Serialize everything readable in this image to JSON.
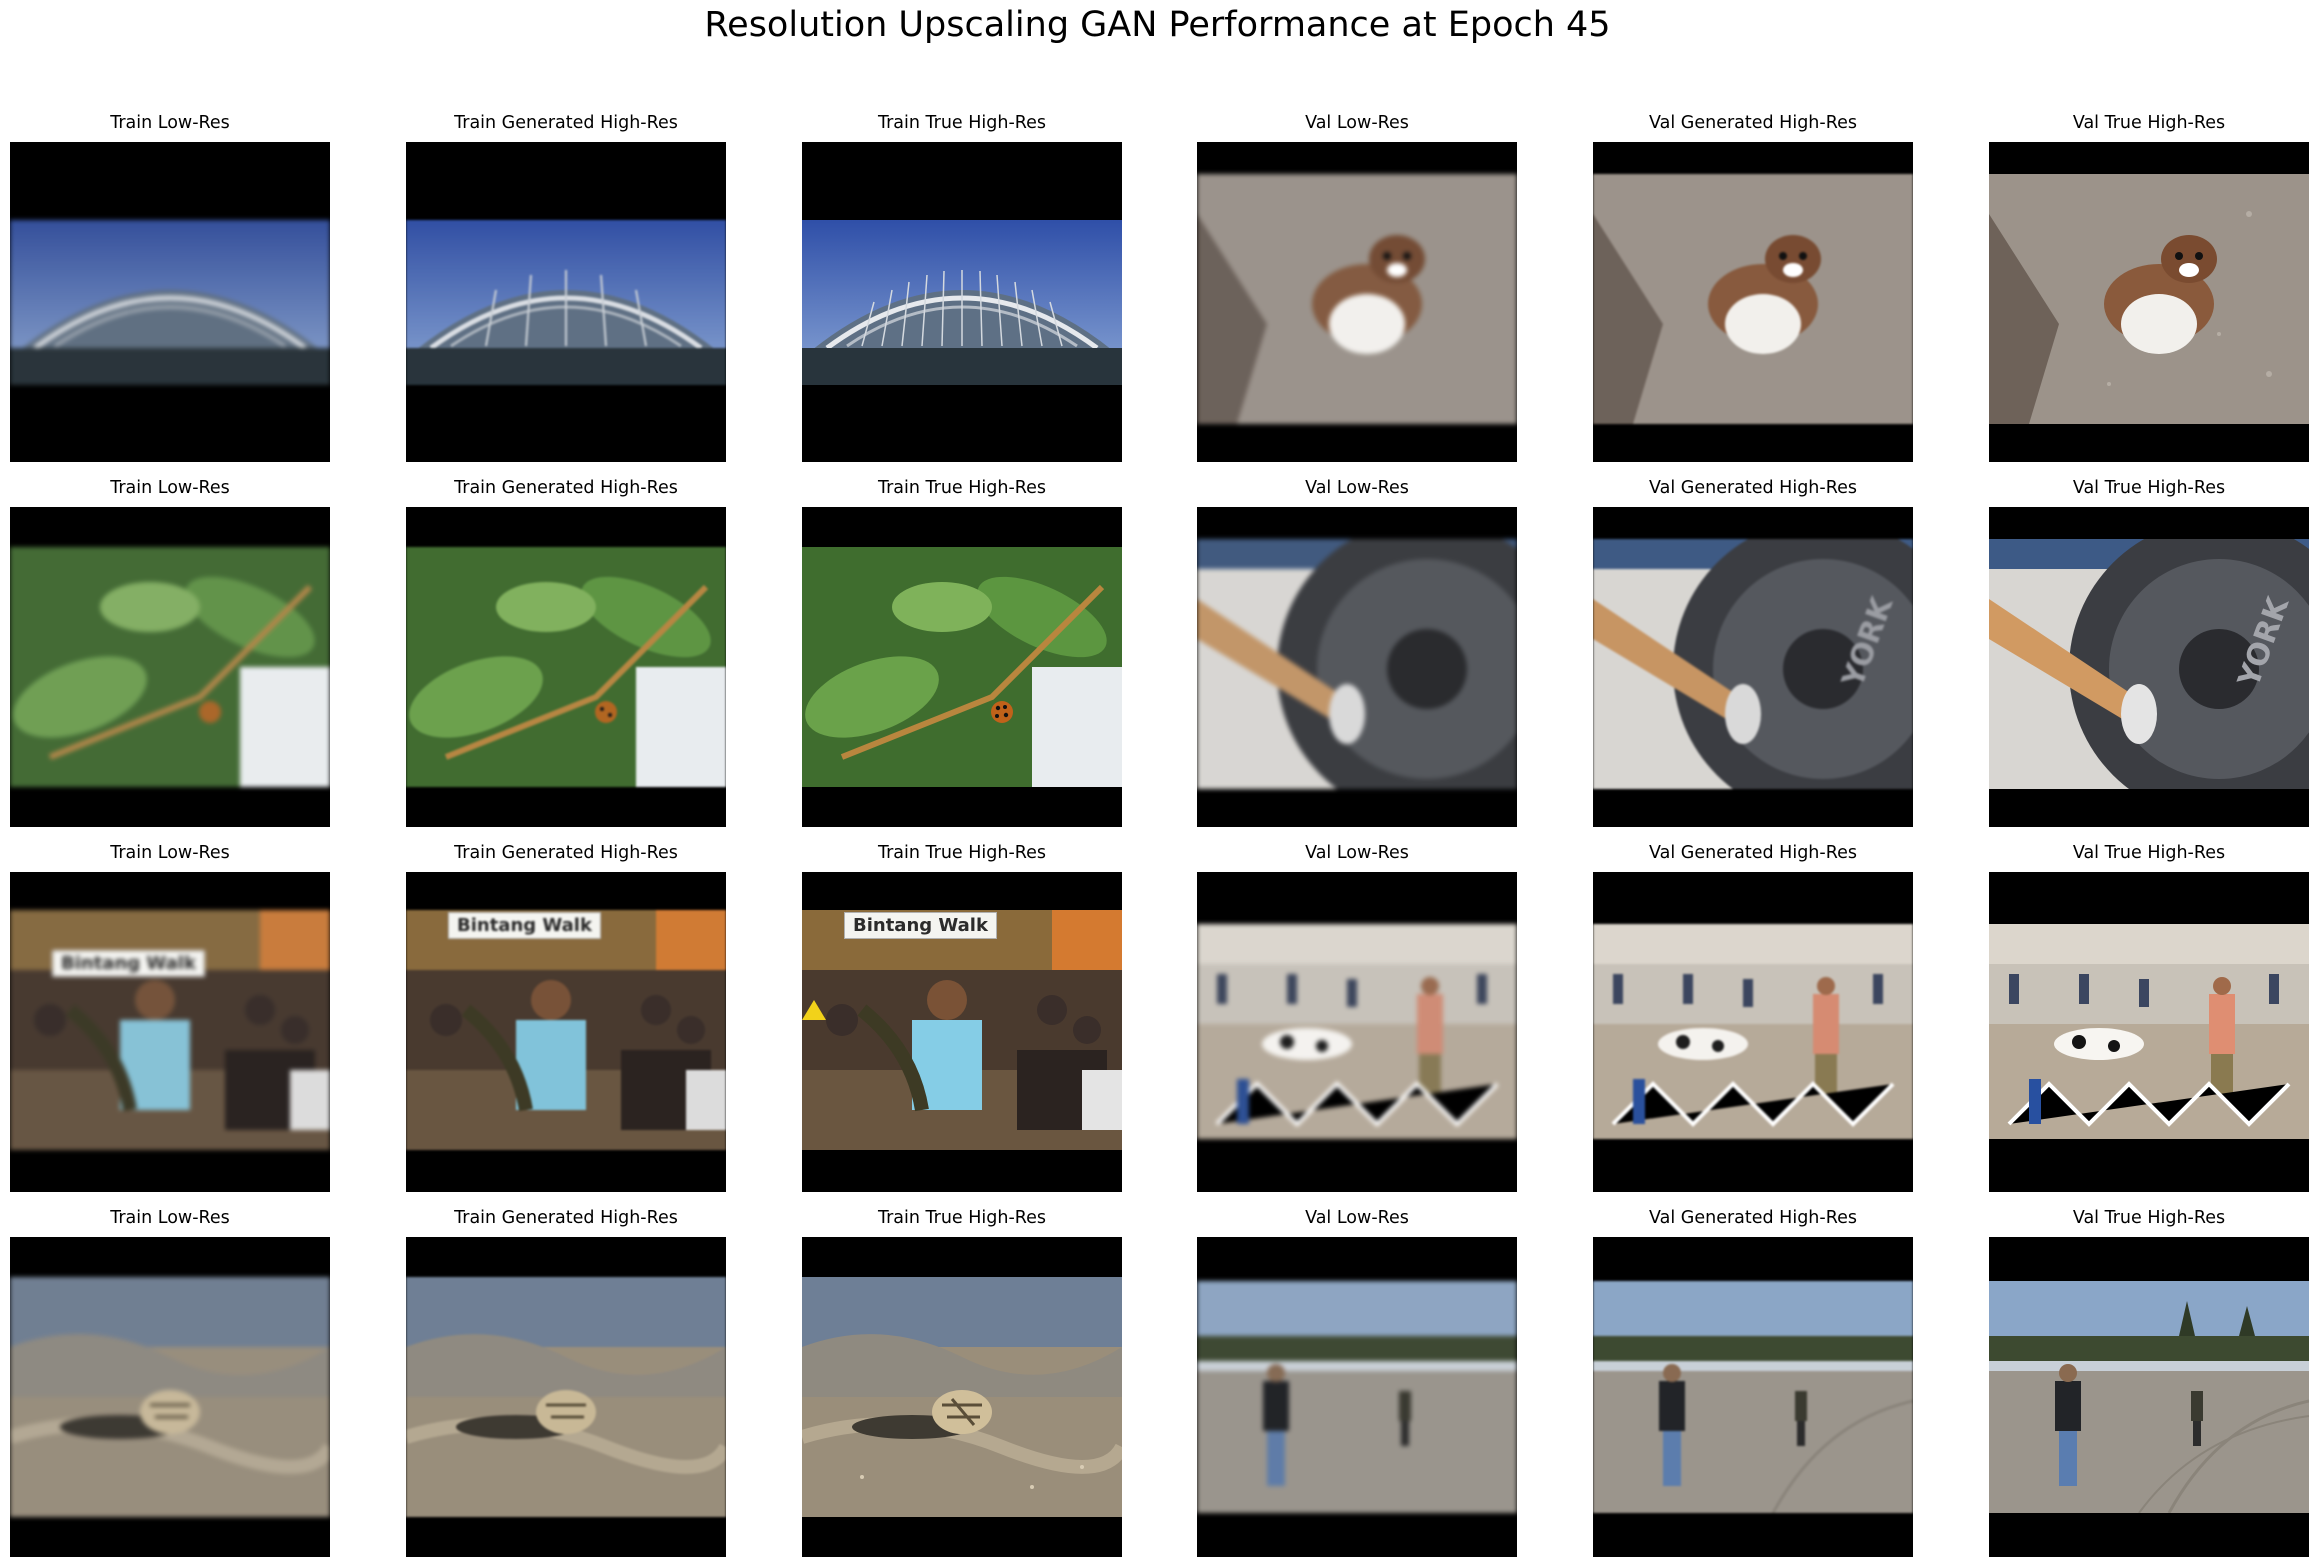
{
  "figure": {
    "title": "Resolution Upscaling GAN Performance at Epoch 45"
  },
  "column_titles": [
    "Train Low-Res",
    "Train Generated High-Res",
    "Train True High-Res",
    "Val Low-Res",
    "Val Generated High-Res",
    "Val True High-Res"
  ],
  "rows": [
    {
      "train_scene": "futuristic-domed-building",
      "val_scene": "stoat-on-rocks"
    },
    {
      "train_scene": "ladybug-on-leaves",
      "val_scene": "barbell-weight-plate",
      "val_plate_text": "YORK"
    },
    {
      "train_scene": "woman-with-snake-crowd",
      "train_sign_text": "Bintang Walk",
      "val_scene": "dog-show-arena"
    },
    {
      "train_scene": "seashell-on-sand",
      "val_scene": "man-walking-plaza"
    }
  ],
  "colors": {
    "letterbox": "#000000",
    "background": "#ffffff"
  }
}
